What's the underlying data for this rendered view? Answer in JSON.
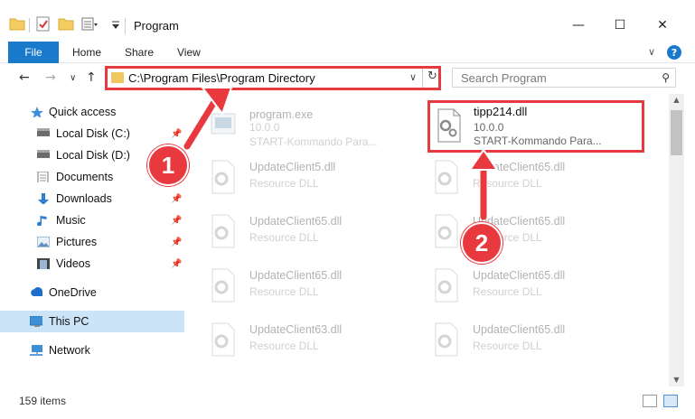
{
  "window": {
    "title": "Program",
    "minimize_glyph": "—",
    "maximize_glyph": "☐",
    "close_glyph": "✕"
  },
  "ribbon": {
    "tabs": [
      "File",
      "Home",
      "Share",
      "View"
    ],
    "expand_glyph": "∨",
    "help_glyph": "?"
  },
  "navigation": {
    "back_glyph": "←",
    "forward_glyph": "→",
    "recent_glyph": "∨",
    "up_glyph": "↑"
  },
  "address_bar": {
    "path": "C:\\Program Files\\Program Directory",
    "dropdown_glyph": "∨",
    "refresh_glyph": "↻"
  },
  "search": {
    "placeholder": "Search Program",
    "icon_glyph": "⚲"
  },
  "sidebar": {
    "items": [
      {
        "label": "Quick access",
        "icon": "star-icon",
        "pinned": false
      },
      {
        "label": "Local Disk (C:)",
        "icon": "drive-icon",
        "pinned": true
      },
      {
        "label": "Local Disk (D:)",
        "icon": "drive-icon",
        "pinned": false
      },
      {
        "label": "Documents",
        "icon": "documents-icon",
        "pinned": true
      },
      {
        "label": "Downloads",
        "icon": "download-icon",
        "pinned": true
      },
      {
        "label": "Music",
        "icon": "music-icon",
        "pinned": true
      },
      {
        "label": "Pictures",
        "icon": "pictures-icon",
        "pinned": true
      },
      {
        "label": "Videos",
        "icon": "videos-icon",
        "pinned": true
      },
      {
        "label": "OneDrive",
        "icon": "cloud-icon",
        "pinned": false
      },
      {
        "label": "This PC",
        "icon": "computer-icon",
        "pinned": false,
        "selected": true
      },
      {
        "label": "Network",
        "icon": "network-icon",
        "pinned": false
      }
    ],
    "pin_glyph": "📌"
  },
  "files": [
    {
      "name": "program.exe",
      "line2": "10.0.0",
      "line3": "START-Kommando Para...",
      "type": "exe"
    },
    {
      "name": "tipp214.dll",
      "line2": "10.0.0",
      "line3": "START-Kommando Para...",
      "type": "dll",
      "highlighted": true
    },
    {
      "name": "UpdateClient5.dll",
      "line2": "Resource DLL",
      "type": "dll"
    },
    {
      "name": "UpdateClient65.dll",
      "line2": "Resource DLL",
      "type": "dll"
    },
    {
      "name": "UpdateClient65.dll",
      "line2": "Resource DLL",
      "type": "dll"
    },
    {
      "name": "UpdateClient65.dll",
      "line2": "Resource DLL",
      "type": "dll"
    },
    {
      "name": "UpdateClient65.dll",
      "line2": "Resource DLL",
      "type": "dll"
    },
    {
      "name": "UpdateClient65.dll",
      "line2": "Resource DLL",
      "type": "dll"
    },
    {
      "name": "UpdateClient63.dll",
      "line2": "Resource DLL",
      "type": "dll"
    },
    {
      "name": "UpdateClient65.dll",
      "line2": "Resource DLL",
      "type": "dll"
    }
  ],
  "status_bar": {
    "item_count": "159 items"
  },
  "annotations": {
    "step1": "1",
    "step2": "2",
    "color": "#e8393f"
  },
  "colors": {
    "accent": "#1979ca",
    "highlight_red": "#e53a40",
    "selected_bg": "#cce4f7"
  }
}
